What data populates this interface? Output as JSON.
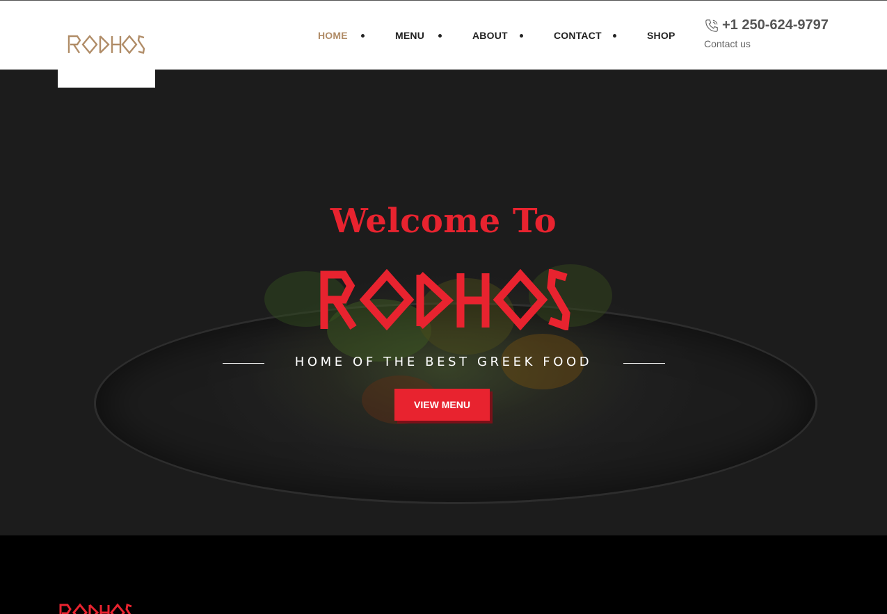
{
  "header": {
    "logo_text": "RODHOS",
    "nav": [
      {
        "label": "HOME",
        "active": true
      },
      {
        "label": "MENU",
        "active": false
      },
      {
        "label": "ABOUT",
        "active": false
      },
      {
        "label": "CONTACT",
        "active": false
      },
      {
        "label": "SHOP",
        "active": false
      }
    ],
    "phone": "+1 250-624-9797",
    "contact_label": "Contact us",
    "phone_icon": "phone-icon"
  },
  "hero": {
    "welcome": "Welcome To",
    "brand": "RODHOS",
    "tagline": "HOME OF THE BEST GREEK FOOD",
    "cta_label": "VIEW MENU"
  },
  "footer": {
    "logo_text": "RODHOS"
  },
  "colors": {
    "accent_red": "#e8232f",
    "nav_active": "#b08c67",
    "header_bg": "#ffffff",
    "hero_bg": "#1f1f1f",
    "footer_bg": "#000000"
  }
}
